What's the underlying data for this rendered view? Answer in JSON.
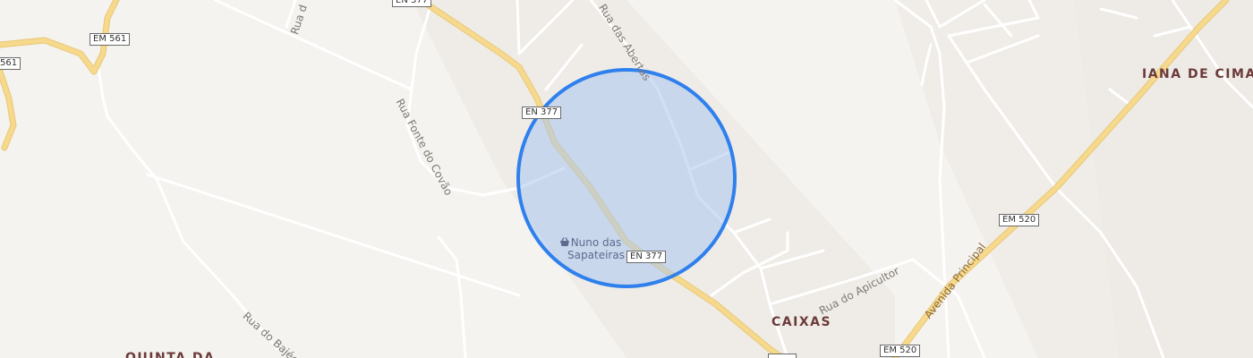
{
  "map": {
    "roads": {
      "EN377_north": "EN 377",
      "EN377_mid": "EN 377",
      "EN377_south": "EN 377",
      "EM561_main": "EM 561",
      "EM561_edge": "561",
      "EM520_mid": "EM 520",
      "EM520_south": "EM 520"
    },
    "streets": {
      "rua_top": "Rua d",
      "rua_abertas": "Rua das Abertas",
      "rua_fonte": "Rua Fonte do Covão",
      "rua_apicultor": "Rua do Apicultor",
      "avenida_principal": "Avenida Principal",
      "rua_bajeca": "Rua do Bajéc"
    },
    "places": {
      "iana_de_cima": "IANA DE CIMA",
      "caixas": "CAIXAS",
      "quinta": "QUINTA DA"
    },
    "poi": {
      "name_line1": "Nuno das",
      "name_line2": "Sapateiras",
      "icon": "basket-icon"
    },
    "accuracy_circle": {
      "fill": "#c5d8f5",
      "stroke": "#2f80ed"
    },
    "colors": {
      "background": "#f5f3ef",
      "primary_road": "#f6d98c",
      "minor_road": "#ffffff"
    }
  }
}
